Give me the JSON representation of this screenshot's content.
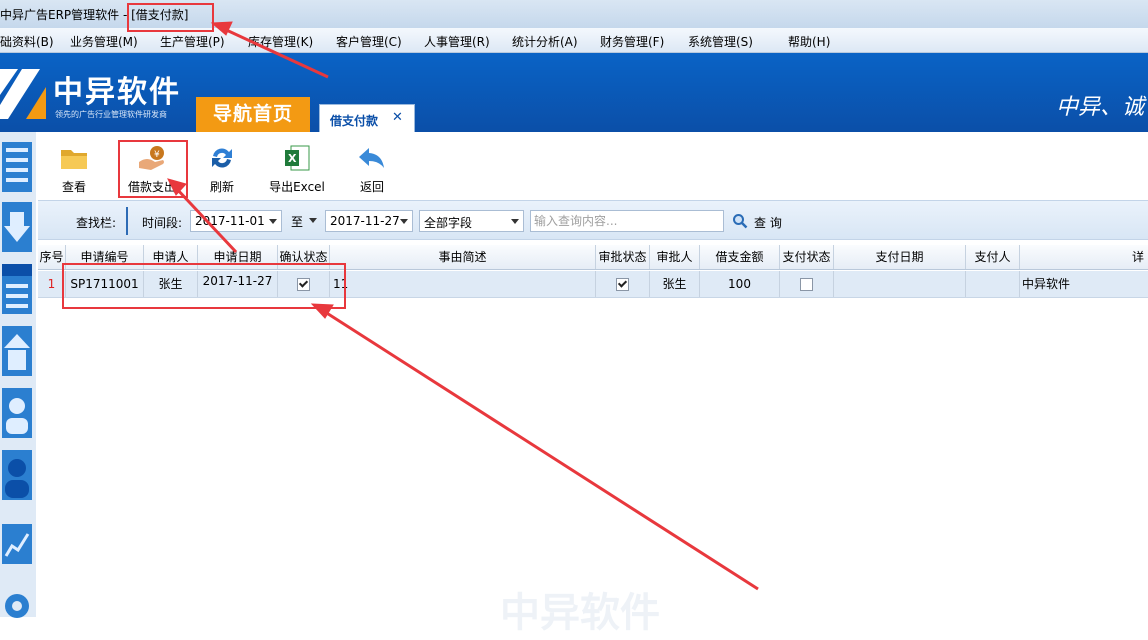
{
  "window": {
    "title": "中异广告ERP管理软件 - [借支付款]"
  },
  "menu": [
    "础资料(B)",
    "业务管理(M)",
    "生产管理(P)",
    "库存管理(K)",
    "客户管理(C)",
    "人事管理(R)",
    "统计分析(A)",
    "财务管理(F)",
    "系统管理(S)",
    "帮助(H)"
  ],
  "brand": {
    "name": "中异软件",
    "tagline": "领先的广告行业管理软件研发商",
    "slogan": "中异、诚"
  },
  "tabs": {
    "home": "导航首页",
    "current": "借支付款",
    "close_glyph": "✕"
  },
  "toolbar": {
    "view": "查看",
    "loan_pay": "借款支出",
    "refresh": "刷新",
    "export": "导出Excel",
    "back": "返回"
  },
  "search": {
    "label": "查找栏:",
    "period_label": "时间段:",
    "date_from": "2017-11-01",
    "to_label": "至",
    "date_to": "2017-11-27",
    "field": "全部字段",
    "placeholder": "输入查询内容...",
    "button": "查 询"
  },
  "table": {
    "columns": [
      "序号",
      "申请编号",
      "申请人",
      "申请日期",
      "确认状态",
      "事由简述",
      "审批状态",
      "审批人",
      "借支金额",
      "支付状态",
      "支付日期",
      "支付人",
      "详"
    ],
    "rows": [
      {
        "index": "1",
        "apply_no": "SP1711001",
        "applicant": "张生",
        "apply_date": "2017-11-27",
        "confirmed": true,
        "reason": "11",
        "approved": true,
        "approver": "张生",
        "amount": "100",
        "paid": false,
        "pay_date": "",
        "payer": "",
        "detail": "中异软件"
      }
    ]
  },
  "watermark": "中异软件",
  "colors": {
    "banner": "#0b4fa8",
    "nav_tab": "#f39a13",
    "annotation": "#e8383d",
    "row_bg": "#dfeaf6"
  }
}
